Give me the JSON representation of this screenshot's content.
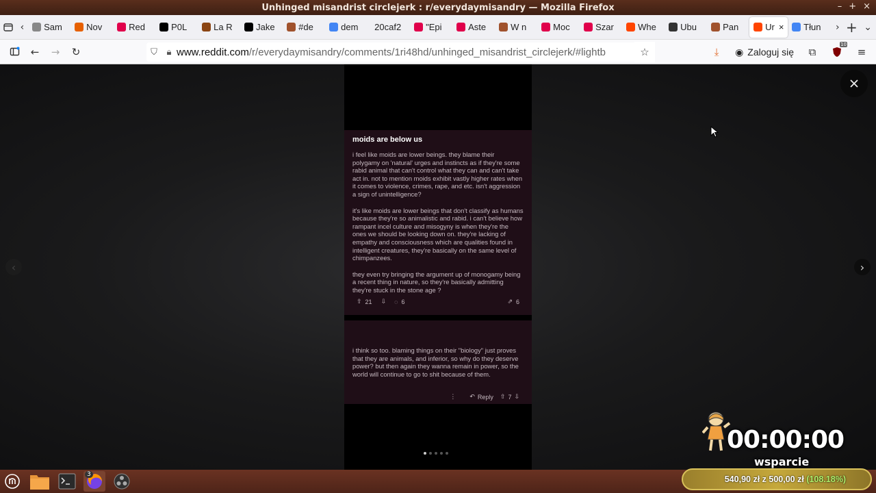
{
  "window": {
    "title": "Unhinged misandrist circlejerk : r/everydaymisandry — Mozilla Firefox",
    "controls": [
      "–",
      "+",
      "×"
    ]
  },
  "tabs": [
    {
      "label": "Sam",
      "icon": "plain-icon",
      "color": "#888888"
    },
    {
      "label": "Nov",
      "icon": "firefox-icon",
      "color": "#e66000"
    },
    {
      "label": "Red",
      "icon": "youtube-icon",
      "color": "#e0004b"
    },
    {
      "label": "P0L",
      "icon": "x-icon",
      "color": "#000000"
    },
    {
      "label": "La R",
      "icon": "shield-icon",
      "color": "#8b4513"
    },
    {
      "label": "Jake",
      "icon": "x-icon",
      "color": "#000000"
    },
    {
      "label": "#de",
      "icon": "bookmark-icon",
      "color": "#a0522d"
    },
    {
      "label": "dem",
      "icon": "google-icon",
      "color": "#4285f4"
    },
    {
      "label": "20caf2",
      "icon": "blank-icon",
      "color": "#ffffff"
    },
    {
      "label": "\"Epi",
      "icon": "youtube-icon",
      "color": "#e0004b"
    },
    {
      "label": "Aste",
      "icon": "youtube-icon",
      "color": "#e0004b"
    },
    {
      "label": "W n",
      "icon": "bookmark-icon",
      "color": "#a0522d"
    },
    {
      "label": "Moc",
      "icon": "youtube-icon",
      "color": "#e0004b"
    },
    {
      "label": "Szar",
      "icon": "youtube-icon",
      "color": "#e0004b"
    },
    {
      "label": "Whe",
      "icon": "reddit-icon",
      "color": "#ff4500"
    },
    {
      "label": "Ubu",
      "icon": "wikipedia-icon",
      "color": "#333333"
    },
    {
      "label": "Pan",
      "icon": "bookmark-icon",
      "color": "#a0522d"
    },
    {
      "label": "Ur",
      "icon": "reddit-icon",
      "color": "#ff4500",
      "active": true
    },
    {
      "label": "Tłun",
      "icon": "translate-icon",
      "color": "#4285f4"
    }
  ],
  "nav": {
    "url_domain": "www.reddit.com",
    "url_path": "/r/everydaymisandry/comments/1ri48hd/unhinged_misandrist_circlejerk/#lightb",
    "login_label": "Zaloguj się",
    "extension_badge": "10"
  },
  "post": {
    "title": "moids are below us",
    "paragraphs": [
      "i feel like moids are lower beings. they blame their polygamy on 'natural' urges and instincts as if they're some rabid animal that can't control what they can and can't take act in. not to mention moids exhibit vastly higher rates when it comes to violence, crimes, rape, and etc. isn't aggression a sign of unintelligence?",
      "it's like moids are lower beings that don't classify as humans because they're so animalistic and rabid. i can't believe how rampant incel culture and misogyny is when they're the ones we should be looking down on. they're lacking of empathy and consciousness which are qualities found in intelligent creatures, they're basically on the same level of chimpanzees.",
      "they even try bringing the argument up of monogamy being a recent thing in nature, so they're basically admitting they're stuck in the stone age ?"
    ],
    "upvotes": "21",
    "comments": "6",
    "shares": "6"
  },
  "comment": {
    "text": "i think so too. blaming things on their \"biology\" just proves that they are animals, and inferior, so why do they deserve power? but then again they wanna remain in power, so the world will continue to go to shit because of them.",
    "reply_label": "Reply",
    "votes": "7"
  },
  "carousel": {
    "count": 5,
    "active": 0
  },
  "stream": {
    "timer": "00:00:00",
    "support_label": "wsparcie",
    "goal_current": "540,90 zł",
    "goal_sep": "z",
    "goal_target": "500,00 zł",
    "goal_percent": "(108.18%)"
  },
  "taskbar": {
    "firefox_badge": "3"
  }
}
